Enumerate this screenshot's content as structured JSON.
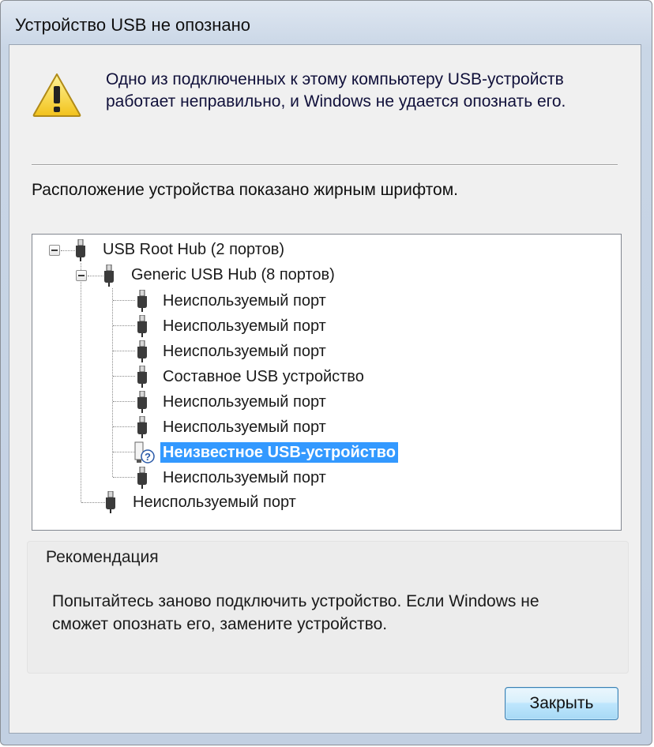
{
  "window": {
    "title": "Устройство USB не опознано"
  },
  "message": {
    "line1": "Одно из подключенных к этому компьютеру USB-устройств",
    "line2": "работает неправильно, и Windows не удается опознать его."
  },
  "location_label": "Расположение устройства показано жирным шрифтом.",
  "tree": {
    "root": "USB Root Hub (2 портов)",
    "hub": "Generic USB Hub (8 портов)",
    "hub_children": [
      "Неиспользуемый порт",
      "Неиспользуемый порт",
      "Неиспользуемый порт",
      "Составное USB устройство",
      "Неиспользуемый порт",
      "Неиспользуемый порт",
      "Неизвестное USB-устройство",
      "Неиспользуемый порт"
    ],
    "root_last_child": "Неиспользуемый порт",
    "selected_index": 6
  },
  "recommendation": {
    "title": "Рекомендация",
    "line1": "Попытайтесь заново подключить устройство. Если Windows не",
    "line2": "сможет опознать его, замените устройство."
  },
  "buttons": {
    "close": "Закрыть"
  },
  "colors": {
    "selection": "#3399ff",
    "window_frame": "#c9d6e6"
  }
}
